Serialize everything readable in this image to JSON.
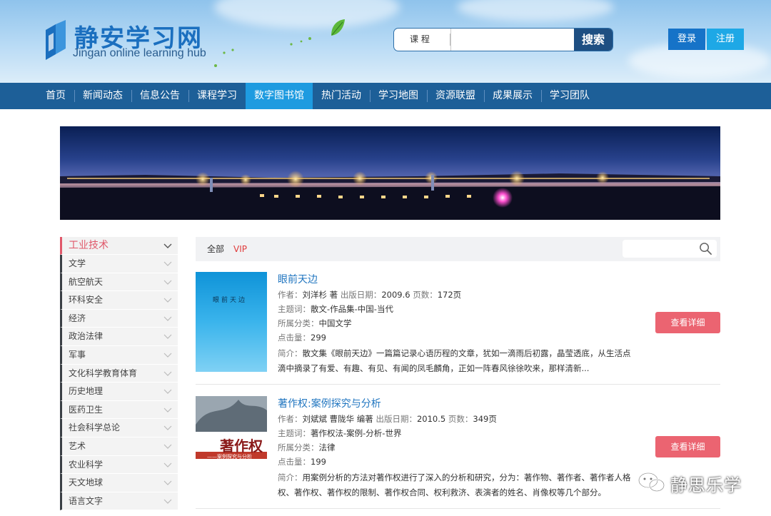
{
  "header": {
    "logo_title": "静安学习网",
    "logo_subtitle": "Jingan online learning hub",
    "search": {
      "category": "课 程",
      "placeholder": "",
      "button": "搜索"
    },
    "login": "登录",
    "register": "注册"
  },
  "nav": {
    "items": [
      "首页",
      "新闻动态",
      "信息公告",
      "课程学习",
      "数字图书馆",
      "热门活动",
      "学习地图",
      "资源联盟",
      "成果展示",
      "学习团队"
    ],
    "active": "数字图书馆"
  },
  "sidebar": {
    "items": [
      "工业技术",
      "文学",
      "航空航天",
      "环科安全",
      "经济",
      "政治法律",
      "军事",
      "文化科学教育体育",
      "历史地理",
      "医药卫生",
      "社会科学总论",
      "艺术",
      "农业科学",
      "天文地球",
      "语言文字"
    ],
    "active": "工业技术"
  },
  "filter": {
    "all": "全部",
    "vip": "VIP",
    "search_placeholder": ""
  },
  "books": [
    {
      "title": "眼前天边",
      "author_label": "作者：",
      "author": "刘洋杉 著",
      "date_label": "出版日期：",
      "date": "2009.6",
      "pages_label": "页数：",
      "pages": "172页",
      "subject_label": "主题词：",
      "subject": "散文-作品集-中国-当代",
      "category_label": "所属分类：",
      "category": "中国文学",
      "clicks_label": "点击量：",
      "clicks": "299",
      "summary_label": "简介：",
      "summary": "散文集《眼前天边》一篇篇记录心语历程的文章，犹如一滴雨后初露，晶莹透底，从生活点滴中摘录了有爱、有趣、有见、有闻的凤毛麟角，正如一阵春风徐徐吹来，那样清新...",
      "cover_text": "眼前天边",
      "detail_button": "查看详细"
    },
    {
      "title": "著作权:案例探究与分析",
      "author_label": "作者：",
      "author": "刘斌斌 曹陇华 编著",
      "date_label": "出版日期：",
      "date": "2010.5",
      "pages_label": "页数：",
      "pages": "349页",
      "subject_label": "主题词：",
      "subject": "著作权法-案例-分析-世界",
      "category_label": "所属分类：",
      "category": "法律",
      "clicks_label": "点击量：",
      "clicks": "199",
      "summary_label": "简介：",
      "summary": "用案例分析的方法对著作权进行了深入的分析和研究，分为：著作物、著作者、著作者人格权、著作权、著作权的限制、著作权合同、权利救济、表演者的姓名、肖像权等几个部分。",
      "cover_text": "著作权",
      "cover_subtext": "——案例探究与分析",
      "detail_button": "查看详细"
    }
  ],
  "watermark": "静思乐学",
  "colors": {
    "nav": "#1d5f98",
    "nav_active": "#1e9be0",
    "accent": "#eb6471",
    "link": "#2176c0",
    "vip": "#e03b3b"
  }
}
